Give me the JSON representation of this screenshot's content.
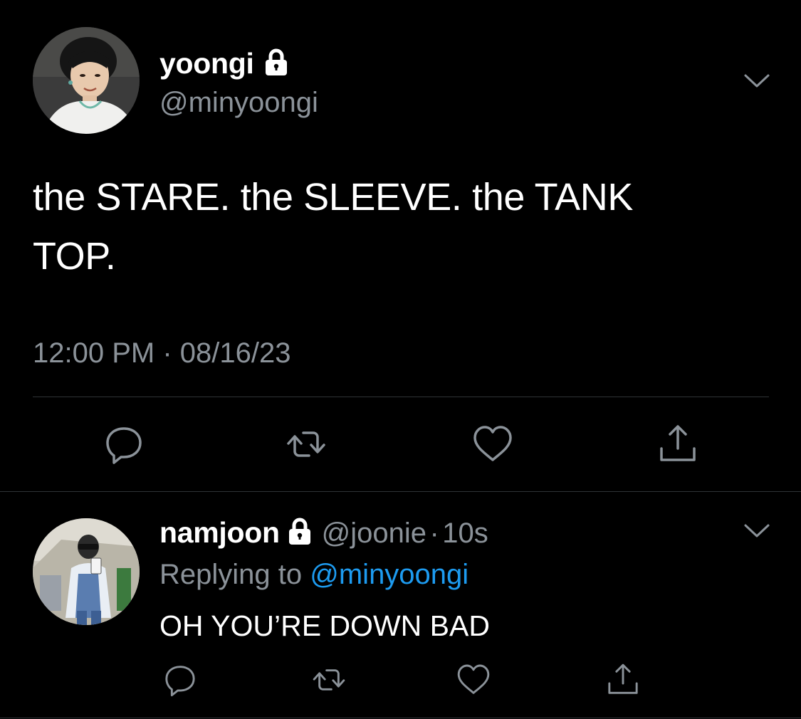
{
  "colors": {
    "background": "#000000",
    "text_primary": "#ffffff",
    "text_secondary": "#8b9299",
    "link": "#1d9bf0",
    "divider": "#2f3336"
  },
  "main_tweet": {
    "display_name": "yoongi",
    "handle": "@minyoongi",
    "text": "the STARE. the SLEEVE. the TANK TOP.",
    "text_line1": "the STARE. the SLEEVE. the TANK",
    "text_line2": "TOP.",
    "time": "12:00 PM",
    "separator": "·",
    "date": "08/16/23",
    "icons": {
      "lock": "lock-icon",
      "menu": "chevron-down-icon",
      "reply": "comment-icon",
      "retweet": "retweet-icon",
      "like": "heart-icon",
      "share": "share-icon"
    }
  },
  "reply_tweet": {
    "display_name": "namjoon",
    "handle": "@joonie",
    "separator": "·",
    "age": "10s",
    "replying_prefix": "Replying to",
    "replying_mention": "@minyoongi",
    "text": "OH YOU’RE DOWN BAD",
    "icons": {
      "lock": "lock-icon",
      "menu": "chevron-down-icon",
      "reply": "comment-icon",
      "retweet": "retweet-icon",
      "like": "heart-icon",
      "share": "share-icon"
    }
  }
}
